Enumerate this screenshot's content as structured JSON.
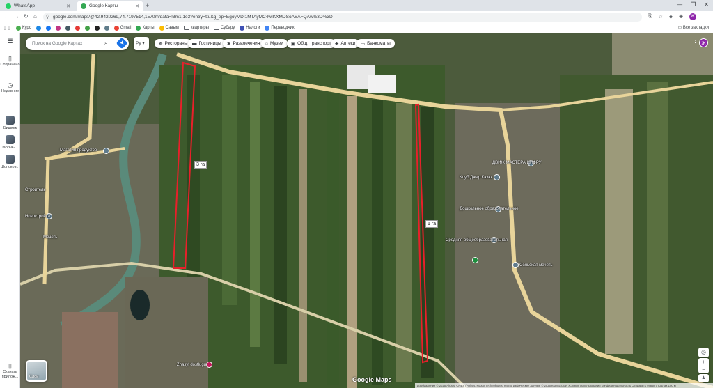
{
  "tabs": [
    {
      "title": "WhatsApp",
      "color": "#25d366"
    },
    {
      "title": "Google Карты",
      "color": "#34a853"
    }
  ],
  "address": {
    "url": "google.com/maps/@42.9420269,74.7197514,1570m/data=!3m1!1e3?entry=ttu&g_ep=EgoyMDI1MTAyMC4wIKXMDSoASAFQAw%3D%3D"
  },
  "bookmarks": [
    "Курс",
    "Gmail",
    "Карты",
    "Савым",
    "квартиры",
    "Субару",
    "Налоги",
    "Переводчик"
  ],
  "bookmarks_all": "Все закладки",
  "rail": {
    "saved": "Сохранено",
    "recent": "Недавние",
    "recent1": "Бишкек",
    "recent2": "Иссык-...",
    "recent3": "Шопоков...",
    "download": "Скачать прилож..."
  },
  "search": {
    "placeholder": "Поиск на Google Картах"
  },
  "lang_button": "Ру",
  "chips": [
    "Рестораны",
    "Гостиницы",
    "Развлечения",
    "Музеи",
    "Общ. транспорт",
    "Аптеки",
    "Банкоматы"
  ],
  "account_initial": "Ж",
  "field_labels": {
    "left": "3 га",
    "right": "1 га"
  },
  "poi": [
    "Магазин продуктов",
    "Строитель",
    "Новостройка",
    "Мечеть",
    "ДВИЖ МАСТЕРА ЦИФРУ",
    "Клуб Джер Казак",
    "Дошкольное образовательное",
    "Средняя общеобразовательная",
    "Сельская мечеть",
    "Zhasyl dostlugu"
  ],
  "layers_label": "Слои",
  "brand": "Google Maps",
  "footer": "Изображения © 2025 Airbus, CNES / Airbus, Maxar Technologies, Картографические данные © 2025   Кыргызстан   Условия использования   Конфиденциальность   Отправить отзыв о Картах   100 м",
  "colors": {
    "field_outline": "#e8202a",
    "road": "#e8d49a",
    "accent": "#1a73e8"
  }
}
